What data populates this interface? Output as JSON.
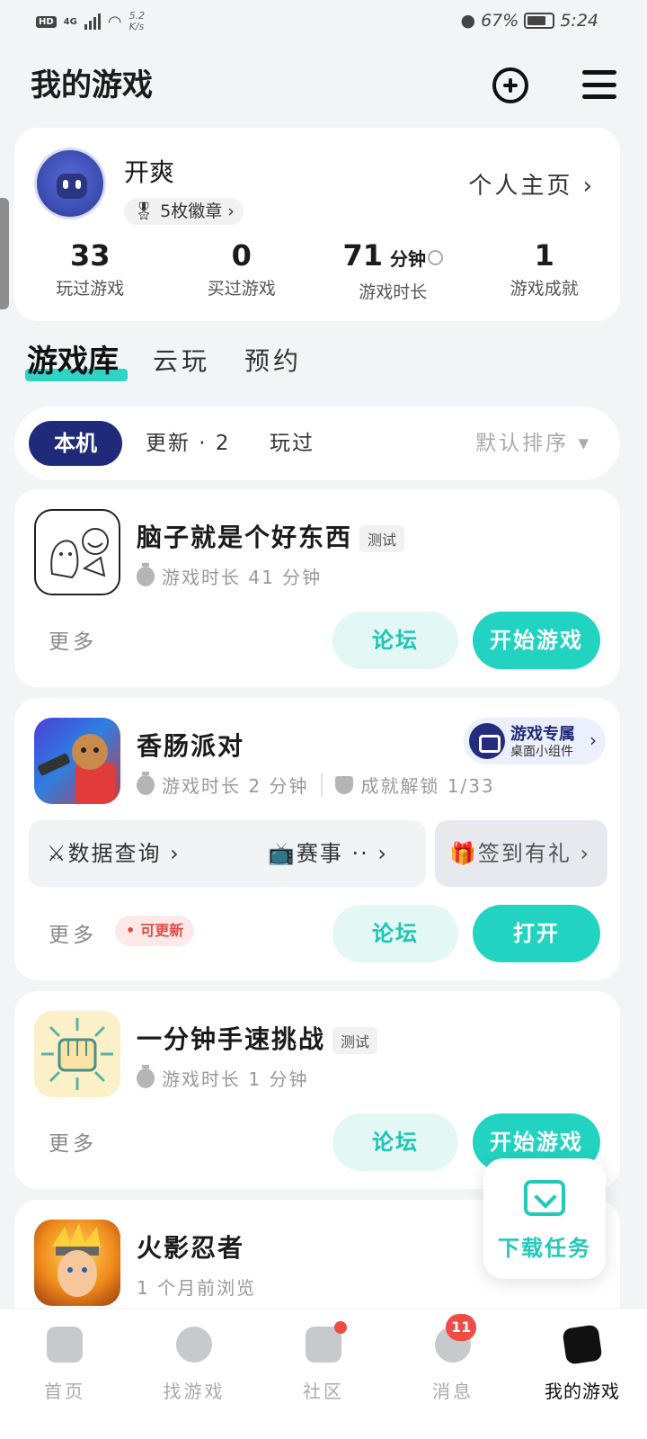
{
  "status_bar": {
    "network": "HD",
    "signal_type": "4G",
    "speed": "5.2",
    "speed_unit": "K/s",
    "battery_percent": "67%",
    "time": "5:24"
  },
  "header": {
    "title": "我的游戏",
    "add_icon": "plus-circle-icon",
    "menu_icon": "hamburger-menu-icon"
  },
  "profile": {
    "username": "开爽",
    "badges": "5枚徽章 ›",
    "homepage_link": "个人主页 ›",
    "stats": [
      {
        "value": "33",
        "unit": "",
        "label": "玩过游戏"
      },
      {
        "value": "0",
        "unit": "",
        "label": "买过游戏"
      },
      {
        "value": "71",
        "unit": "分钟",
        "label": "游戏时长"
      },
      {
        "value": "1",
        "unit": "",
        "label": "游戏成就"
      }
    ]
  },
  "library_tabs": [
    "游戏库",
    "云玩",
    "预约"
  ],
  "filters": {
    "active": "本机",
    "items": [
      "更新 · 2",
      "玩过"
    ],
    "sort": "默认排序 ▾"
  },
  "games": [
    {
      "name": "脑子就是个好东西",
      "tag": "测试",
      "playtime": "游戏时长 41 分钟",
      "more": "更多",
      "forum": "论坛",
      "action": "开始游戏"
    },
    {
      "name": "香肠派对",
      "playtime": "游戏时长 2 分钟",
      "achievement": "成就解锁 1/33",
      "widget_title": "游戏专属",
      "widget_subtitle": "桌面小组件",
      "quick_links": [
        "⚔数据查询 ›",
        "📺赛事 ·· ›",
        "🎁签到有礼 ›"
      ],
      "more": "更多",
      "update_tag": "可更新",
      "forum": "论坛",
      "action": "打开"
    },
    {
      "name": "一分钟手速挑战",
      "tag": "测试",
      "playtime": "游戏时长 1 分钟",
      "more": "更多",
      "forum": "论坛",
      "action": "开始游戏"
    },
    {
      "name": "火影忍者",
      "playtime": "1 个月前浏览"
    }
  ],
  "download_task": {
    "label": "下载任务"
  },
  "bottom_nav": [
    {
      "label": "首页"
    },
    {
      "label": "找游戏"
    },
    {
      "label": "社区"
    },
    {
      "label": "消息",
      "badge": "11"
    },
    {
      "label": "我的游戏"
    }
  ],
  "colors": {
    "accent": "#22d3c2",
    "navy": "#1f2a7a",
    "alert": "#f14b45"
  }
}
